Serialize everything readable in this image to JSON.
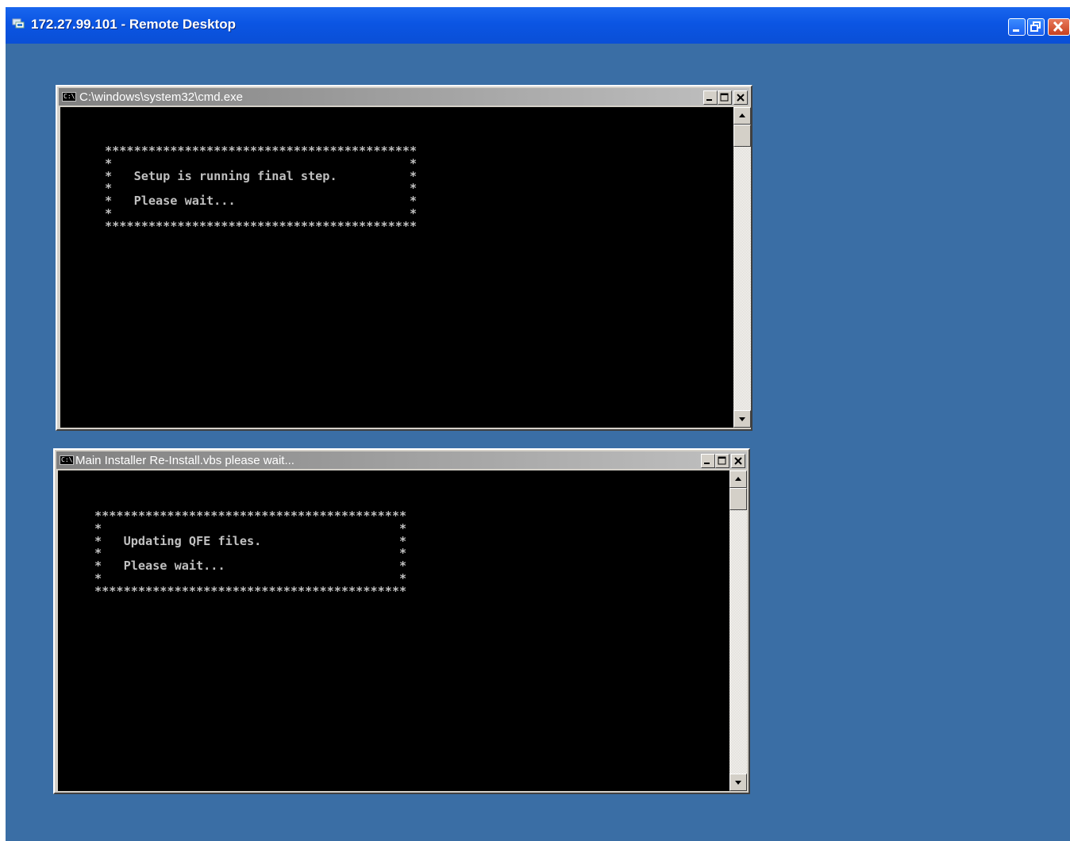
{
  "remote_desktop": {
    "title": "172.27.99.101 - Remote Desktop",
    "icon": "remote-desktop-icon",
    "controls": [
      "minimize-icon",
      "restore-icon",
      "close-icon"
    ]
  },
  "desktop": {
    "background_color": "#3a6ea5"
  },
  "windows": [
    {
      "title": "C:\\windows\\system32\\cmd.exe",
      "icon_label": "C:\\",
      "console_lines": "*******************************************\n*                                         *\n*   Setup is running final step.          *\n*                                         *\n*   Please wait...                        *\n*                                         *\n*******************************************"
    },
    {
      "title": "Main Installer Re-Install.vbs please wait...",
      "icon_label": "C:\\",
      "console_lines": "*******************************************\n*                                         *\n*   Updating QFE files.                   *\n*                                         *\n*   Please wait...                        *\n*                                         *\n*******************************************"
    }
  ],
  "colors": {
    "console_bg": "#000000",
    "console_text": "#c0c0c0",
    "titlebar_inactive_start": "#808080",
    "titlebar_inactive_end": "#c0c0c0",
    "xp_title_blue": "#0b55e3"
  }
}
